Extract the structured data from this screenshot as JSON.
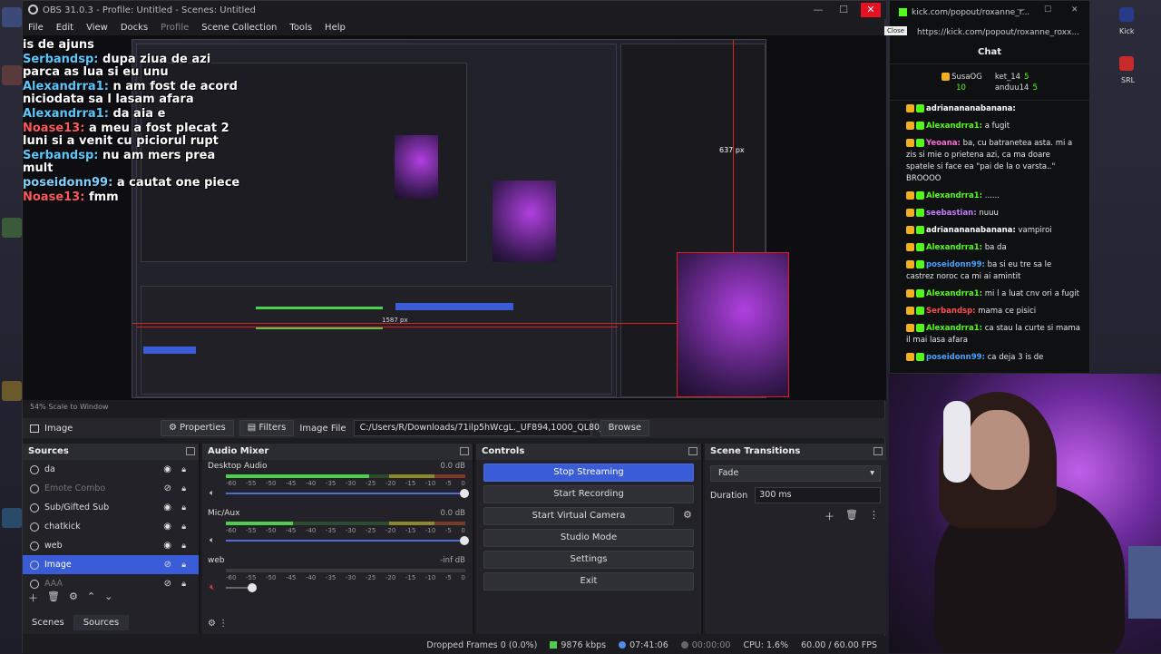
{
  "obs": {
    "title": "OBS 31.0.3 - Profile: Untitled - Scenes: Untitled",
    "menu": [
      "File",
      "Edit",
      "View",
      "Docks",
      "Profile",
      "Scene Collection",
      "Tools",
      "Help"
    ],
    "preview_status": "54%   Scale to Window",
    "preview_chat": [
      {
        "user": "",
        "text": "is de ajuns"
      },
      {
        "user": "Serbandsp:",
        "text": "dupa ziua de azi parca as lua si eu unu"
      },
      {
        "user": "Alexandrra1:",
        "text": "n am fost de acord niciodata sa l lasam afara"
      },
      {
        "user": "Alexandrra1:",
        "text": "da aia e"
      },
      {
        "user": "Noase13:",
        "text": "a meu a fost plecat 2 luni si a venit cu piciorul rupt"
      },
      {
        "user": "Serbandsp:",
        "text": "nu am mers prea mult"
      },
      {
        "user": "poseidonn99:",
        "text": "a cautat one piece"
      },
      {
        "user": "Noase13:",
        "text": "fmm"
      }
    ],
    "nested_labels": {
      "px637": "637 px",
      "px1587": "1587 px"
    },
    "properties_bar": {
      "source_name": "Image",
      "properties": "Properties",
      "filters": "Filters",
      "image_file_label": "Image File",
      "image_file_path": "C:/Users/R/Downloads/71ilp5hWcgL._UF894,1000_QL80_.jpg",
      "browse": "Browse"
    },
    "sources": {
      "title": "Sources",
      "items": [
        {
          "name": "da",
          "selected": false,
          "visible": true
        },
        {
          "name": "Emote Combo",
          "selected": false,
          "visible": false
        },
        {
          "name": "Sub/Gifted Sub",
          "selected": false,
          "visible": true
        },
        {
          "name": "chatkick",
          "selected": false,
          "visible": true
        },
        {
          "name": "web",
          "selected": false,
          "visible": true
        },
        {
          "name": "Image",
          "selected": true,
          "visible": false
        },
        {
          "name": "AAA",
          "selected": false,
          "visible": false
        }
      ],
      "tabs": [
        "Scenes",
        "Sources"
      ]
    },
    "audio_mixer": {
      "title": "Audio Mixer",
      "ticks": [
        "-60",
        "-55",
        "-50",
        "-45",
        "-40",
        "-35",
        "-30",
        "-25",
        "-20",
        "-15",
        "-10",
        "-5",
        "0"
      ],
      "channels": [
        {
          "name": "Desktop Audio",
          "db": "0.0 dB",
          "level": 0.6
        },
        {
          "name": "Mic/Aux",
          "db": "0.0 dB",
          "level": 0.28
        },
        {
          "name": "web",
          "db": "-inf dB",
          "level": 0
        }
      ]
    },
    "controls": {
      "title": "Controls",
      "buttons": [
        "Stop Streaming",
        "Start Recording",
        "Start Virtual Camera",
        "Studio Mode",
        "Settings",
        "Exit"
      ]
    },
    "scene_transitions": {
      "title": "Scene Transitions",
      "transition": "Fade",
      "duration_label": "Duration",
      "duration": "300 ms"
    },
    "statusbar": {
      "dropped": "Dropped Frames 0 (0.0%)",
      "kbps": "9876 kbps",
      "live_time": "07:41:06",
      "rec_time": "00:00:00",
      "cpu": "CPU: 1.6%",
      "fps": "60.00 / 60.00 FPS"
    }
  },
  "kick": {
    "window_title": "kick.com/popout/roxanne_r...",
    "url": "https://kick.com/popout/roxanne_roxx...",
    "close_tooltip": "Close",
    "chat_title": "Chat",
    "leaderboard": {
      "top_user": "SusaOG",
      "top_count": "10",
      "others": [
        {
          "user": "ket_14",
          "count": "5"
        },
        {
          "user": "anduu14",
          "count": "5"
        }
      ]
    },
    "messages": [
      {
        "user": "adrianananabanana:",
        "text": "",
        "color": "#ffffff"
      },
      {
        "user": "Alexandrra1:",
        "text": "a fugit",
        "color": "#53fc18"
      },
      {
        "user": "Yeoana:",
        "text": "ba, cu batranetea asta. mi a zis si mie o prietena azi, ca ma doare spatele si face ea \"pai de la o varsta..\" BROOOO",
        "color": "#ff6ad5"
      },
      {
        "user": "Alexandrra1:",
        "text": "......",
        "color": "#53fc18"
      },
      {
        "user": "seebastian:",
        "text": "nuuu",
        "color": "#c57cff"
      },
      {
        "user": "adrianananabanana:",
        "text": "vampiroi",
        "color": "#ffffff"
      },
      {
        "user": "Alexandrra1:",
        "text": "ba da",
        "color": "#53fc18"
      },
      {
        "user": "poseidonn99:",
        "text": "ba si eu tre sa le castrez noroc ca mi ai amintit",
        "color": "#4aa3ff"
      },
      {
        "user": "Alexandrra1:",
        "text": "mi l a luat cnv ori a fugit",
        "color": "#53fc18"
      },
      {
        "user": "Serbandsp:",
        "text": "mama ce pisici",
        "color": "#ff5050"
      },
      {
        "user": "Alexandrra1:",
        "text": "ca stau la curte si mama il mai lasa afara",
        "color": "#53fc18"
      },
      {
        "user": "poseidonn99:",
        "text": "ca deja 3 is de",
        "color": "#4aa3ff"
      }
    ]
  },
  "desktop": {
    "right_icons": [
      "Kick",
      "SRL"
    ]
  }
}
